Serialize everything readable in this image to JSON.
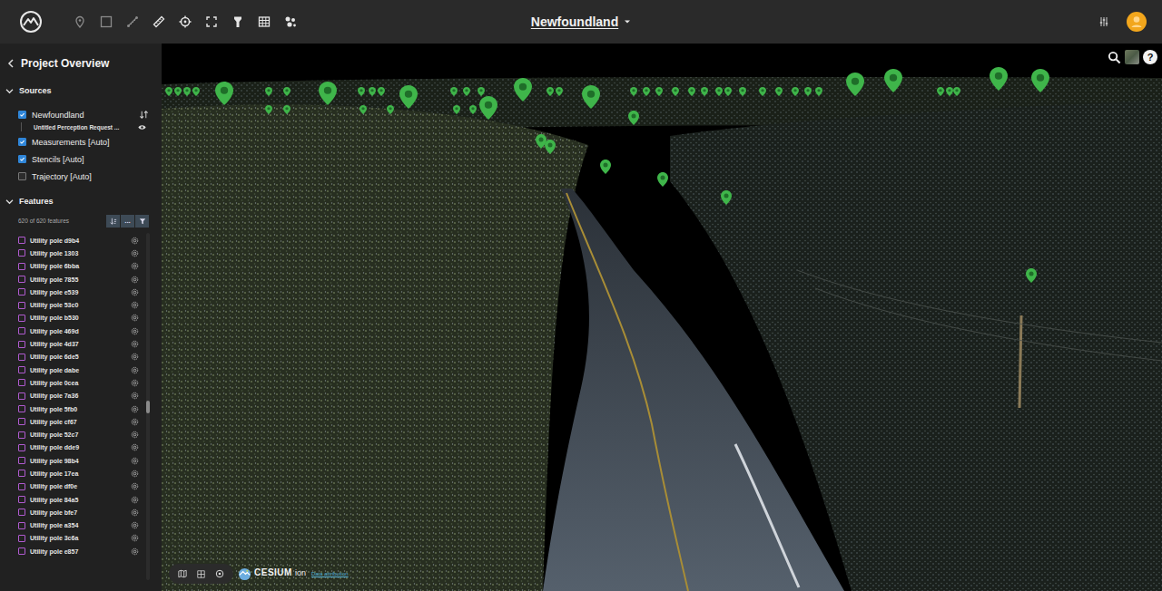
{
  "topbar": {
    "title": "Newfoundland",
    "tools": [
      {
        "kind": "pin",
        "disabled": true
      },
      {
        "kind": "rectangle",
        "disabled": true
      },
      {
        "kind": "polyline",
        "disabled": true
      },
      {
        "kind": "ruler",
        "disabled": false
      },
      {
        "kind": "target",
        "disabled": false
      },
      {
        "kind": "frame",
        "disabled": false
      },
      {
        "kind": "flashlight",
        "disabled": false
      },
      {
        "kind": "grid",
        "disabled": false
      },
      {
        "kind": "cluster",
        "disabled": false
      }
    ]
  },
  "sidebar": {
    "title": "Project Overview",
    "sources": {
      "title": "Sources",
      "expanded": true,
      "items": [
        {
          "label": "Newfoundland",
          "checked": true,
          "kind": "project",
          "children": [
            {
              "label": "Untitled Perception Request ...",
              "visible": true
            }
          ]
        },
        {
          "label": "Measurements [Auto]",
          "checked": true,
          "kind": "layer",
          "children": []
        },
        {
          "label": "Stencils [Auto]",
          "checked": true,
          "kind": "layer",
          "children": []
        },
        {
          "label": "Trajectory [Auto]",
          "checked": false,
          "kind": "layer",
          "children": []
        }
      ]
    },
    "features": {
      "title": "Features",
      "expanded": true,
      "count": "620 of 620 features",
      "more": "...",
      "scroll_level": 0.5,
      "rows": [
        {
          "label": "Utility pole d9b4",
          "checked": false
        },
        {
          "label": "Utility pole 1303",
          "checked": false
        },
        {
          "label": "Utility pole 6bba",
          "checked": false
        },
        {
          "label": "Utility pole 7855",
          "checked": false
        },
        {
          "label": "Utility pole e539",
          "checked": false
        },
        {
          "label": "Utility pole 53c0",
          "checked": false
        },
        {
          "label": "Utility pole b530",
          "checked": false
        },
        {
          "label": "Utility pole 469d",
          "checked": false
        },
        {
          "label": "Utility pole 4d37",
          "checked": false
        },
        {
          "label": "Utility pole 6de5",
          "checked": false
        },
        {
          "label": "Utility pole dabe",
          "checked": false
        },
        {
          "label": "Utility pole 0cea",
          "checked": false
        },
        {
          "label": "Utility pole 7a36",
          "checked": false
        },
        {
          "label": "Utility pole 5fb0",
          "checked": false
        },
        {
          "label": "Utility pole cf67",
          "checked": false
        },
        {
          "label": "Utility pole 52c7",
          "checked": false
        },
        {
          "label": "Utility pole dde9",
          "checked": false
        },
        {
          "label": "Utility pole 98b4",
          "checked": false
        },
        {
          "label": "Utility pole 17ea",
          "checked": false
        },
        {
          "label": "Utility pole df0e",
          "checked": false
        },
        {
          "label": "Utility pole 84a5",
          "checked": false
        },
        {
          "label": "Utility pole bfe7",
          "checked": false
        },
        {
          "label": "Utility pole a354",
          "checked": false
        },
        {
          "label": "Utility pole 3c6a",
          "checked": false
        },
        {
          "label": "Utility pole e857",
          "checked": false
        }
      ]
    }
  },
  "viewport": {
    "help": "?",
    "pins": [
      {
        "kind": "large"
      },
      {
        "kind": "large"
      },
      {
        "kind": "large"
      },
      {
        "kind": "large"
      },
      {
        "kind": "large"
      },
      {
        "kind": "large"
      },
      {
        "kind": "large"
      },
      {
        "kind": "large"
      },
      {
        "kind": "large"
      },
      {
        "kind": "large"
      },
      {
        "kind": "small"
      },
      {
        "kind": "small"
      },
      {
        "kind": "small"
      },
      {
        "kind": "small"
      },
      {
        "kind": "small"
      },
      {
        "kind": "small"
      },
      {
        "kind": "small"
      },
      {
        "kind": "tiny"
      },
      {
        "kind": "tiny"
      },
      {
        "kind": "tiny"
      },
      {
        "kind": "tiny"
      },
      {
        "kind": "tiny"
      },
      {
        "kind": "tiny"
      },
      {
        "kind": "tiny"
      },
      {
        "kind": "tiny"
      },
      {
        "kind": "tiny"
      },
      {
        "kind": "tiny"
      },
      {
        "kind": "tiny"
      },
      {
        "kind": "tiny"
      },
      {
        "kind": "tiny"
      },
      {
        "kind": "tiny"
      },
      {
        "kind": "tiny"
      },
      {
        "kind": "tiny"
      },
      {
        "kind": "tiny"
      },
      {
        "kind": "tiny"
      },
      {
        "kind": "tiny"
      },
      {
        "kind": "tiny"
      },
      {
        "kind": "tiny"
      },
      {
        "kind": "tiny"
      },
      {
        "kind": "tiny"
      },
      {
        "kind": "tiny"
      },
      {
        "kind": "tiny"
      },
      {
        "kind": "tiny"
      },
      {
        "kind": "tiny"
      },
      {
        "kind": "tiny"
      },
      {
        "kind": "tiny"
      },
      {
        "kind": "tiny"
      },
      {
        "kind": "tiny"
      },
      {
        "kind": "tiny"
      },
      {
        "kind": "tiny"
      },
      {
        "kind": "tiny"
      },
      {
        "kind": "tiny"
      },
      {
        "kind": "tiny"
      },
      {
        "kind": "tiny"
      }
    ],
    "attribution": {
      "brand": "CESIUM",
      "product": "ion",
      "link": "Data attribution"
    }
  }
}
